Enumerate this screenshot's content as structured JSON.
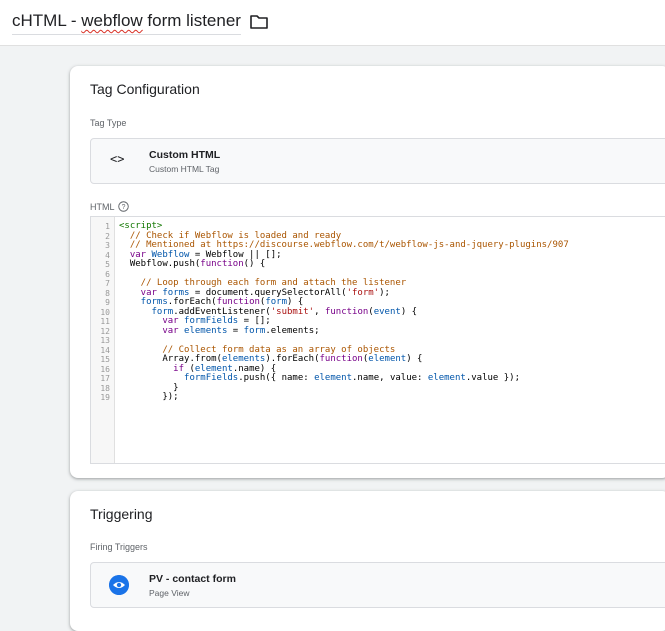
{
  "header": {
    "tag_name_prefix": "cHTML - ",
    "tag_name_word": "webflow",
    "tag_name_suffix": " form listener",
    "folder_icon": "folder-icon"
  },
  "config": {
    "title": "Tag Configuration",
    "tag_type_label": "Tag Type",
    "tag_type": {
      "icon": "code-brackets-icon",
      "icon_text": "<>",
      "name": "Custom HTML",
      "subtitle": "Custom HTML Tag"
    },
    "html_label": "HTML",
    "help_icon": "help-circle-icon"
  },
  "code": {
    "line_numbers": [
      "1",
      "2",
      "3",
      "4",
      "5",
      "6",
      "7",
      "8",
      "9",
      "10",
      "11",
      "12",
      "13",
      "14",
      "15",
      "16",
      "17",
      "18",
      "19"
    ],
    "lines": [
      [
        {
          "c": "t",
          "x": "<script>"
        }
      ],
      [
        {
          "c": "cm",
          "x": "  // Check if Webflow is loaded and ready"
        }
      ],
      [
        {
          "c": "cm",
          "x": "  // Mentioned at https://discourse.webflow.com/t/webflow-js-and-jquery-plugins/907"
        }
      ],
      [
        {
          "c": "k",
          "x": "  var "
        },
        {
          "c": "v",
          "x": "Webflow"
        },
        {
          "c": "",
          "x": " = Webflow || [];"
        }
      ],
      [
        {
          "c": "",
          "x": "  Webflow.push("
        },
        {
          "c": "k",
          "x": "function"
        },
        {
          "c": "",
          "x": "() {"
        }
      ],
      [
        {
          "c": "",
          "x": ""
        }
      ],
      [
        {
          "c": "cm",
          "x": "    // Loop through each form and attach the listener"
        }
      ],
      [
        {
          "c": "k",
          "x": "    var "
        },
        {
          "c": "v",
          "x": "forms"
        },
        {
          "c": "",
          "x": " = document.querySelectorAll("
        },
        {
          "c": "s",
          "x": "'form'"
        },
        {
          "c": "",
          "x": ");"
        }
      ],
      [
        {
          "c": "v",
          "x": "    forms"
        },
        {
          "c": "",
          "x": ".forEach("
        },
        {
          "c": "k",
          "x": "function"
        },
        {
          "c": "",
          "x": "("
        },
        {
          "c": "v",
          "x": "form"
        },
        {
          "c": "",
          "x": ") {"
        }
      ],
      [
        {
          "c": "v",
          "x": "      form"
        },
        {
          "c": "",
          "x": ".addEventListener("
        },
        {
          "c": "s",
          "x": "'submit'"
        },
        {
          "c": "",
          "x": ", "
        },
        {
          "c": "k",
          "x": "function"
        },
        {
          "c": "",
          "x": "("
        },
        {
          "c": "v",
          "x": "event"
        },
        {
          "c": "",
          "x": ") {"
        }
      ],
      [
        {
          "c": "k",
          "x": "        var "
        },
        {
          "c": "v",
          "x": "formFields"
        },
        {
          "c": "",
          "x": " = [];"
        }
      ],
      [
        {
          "c": "k",
          "x": "        var "
        },
        {
          "c": "v",
          "x": "elements"
        },
        {
          "c": "",
          "x": " = "
        },
        {
          "c": "v",
          "x": "form"
        },
        {
          "c": "",
          "x": ".elements;"
        }
      ],
      [
        {
          "c": "",
          "x": ""
        }
      ],
      [
        {
          "c": "cm",
          "x": "        // Collect form data as an array of objects"
        }
      ],
      [
        {
          "c": "",
          "x": "        Array.from("
        },
        {
          "c": "v",
          "x": "elements"
        },
        {
          "c": "",
          "x": ").forEach("
        },
        {
          "c": "k",
          "x": "function"
        },
        {
          "c": "",
          "x": "("
        },
        {
          "c": "v",
          "x": "element"
        },
        {
          "c": "",
          "x": ") {"
        }
      ],
      [
        {
          "c": "k",
          "x": "          if"
        },
        {
          "c": "",
          "x": " ("
        },
        {
          "c": "v",
          "x": "element"
        },
        {
          "c": "",
          "x": ".name) {"
        }
      ],
      [
        {
          "c": "v",
          "x": "            formFields"
        },
        {
          "c": "",
          "x": ".push({ name: "
        },
        {
          "c": "v",
          "x": "element"
        },
        {
          "c": "",
          "x": ".name, value: "
        },
        {
          "c": "v",
          "x": "element"
        },
        {
          "c": "",
          "x": ".value });"
        }
      ],
      [
        {
          "c": "",
          "x": "          }"
        }
      ],
      [
        {
          "c": "",
          "x": "        });"
        }
      ]
    ]
  },
  "triggering": {
    "title": "Triggering",
    "firing_label": "Firing Triggers",
    "trigger": {
      "icon": "eye-icon",
      "name": "PV - contact form",
      "type": "Page View"
    }
  }
}
